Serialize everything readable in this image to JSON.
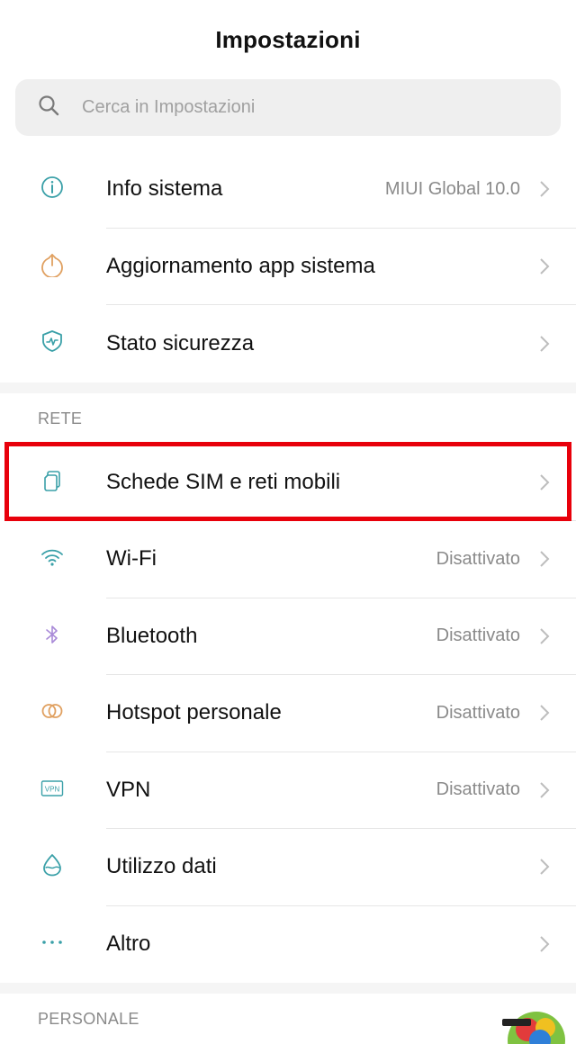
{
  "header": {
    "title": "Impostazioni"
  },
  "search": {
    "placeholder": "Cerca in Impostazioni",
    "icon": "search-icon"
  },
  "sections": {
    "system": {
      "items": [
        {
          "label": "Info sistema",
          "value": "MIUI Global 10.0",
          "icon": "info-icon"
        },
        {
          "label": "Aggiornamento app sistema",
          "value": "",
          "icon": "update-arrow-icon"
        },
        {
          "label": "Stato sicurezza",
          "value": "",
          "icon": "shield-icon"
        }
      ]
    },
    "network": {
      "title": "RETE",
      "items": [
        {
          "label": "Schede SIM e reti mobili",
          "value": "",
          "icon": "sim-card-icon"
        },
        {
          "label": "Wi-Fi",
          "value": "Disattivato",
          "icon": "wifi-icon"
        },
        {
          "label": "Bluetooth",
          "value": "Disattivato",
          "icon": "bluetooth-icon"
        },
        {
          "label": "Hotspot personale",
          "value": "Disattivato",
          "icon": "hotspot-icon"
        },
        {
          "label": "VPN",
          "value": "Disattivato",
          "icon": "vpn-icon"
        },
        {
          "label": "Utilizzo dati",
          "value": "",
          "icon": "data-usage-icon"
        },
        {
          "label": "Altro",
          "value": "",
          "icon": "more-dots-icon"
        }
      ]
    },
    "personal": {
      "title": "PERSONALE"
    }
  },
  "colors": {
    "highlight": "#e8000b",
    "icon_teal": "#3aa0a8",
    "icon_orange": "#e0a060",
    "icon_purple": "#a98ad8",
    "chevron": "#bdbdbd"
  }
}
